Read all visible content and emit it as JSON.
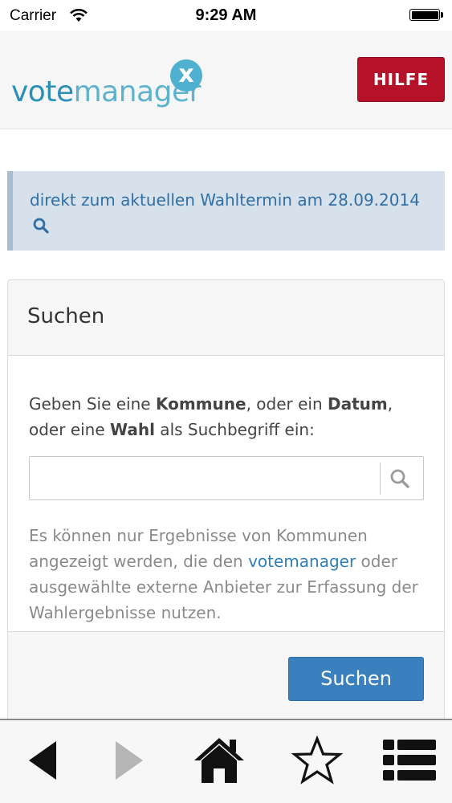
{
  "status_bar": {
    "carrier": "Carrier",
    "time": "9:29 AM"
  },
  "header": {
    "logo": {
      "word_1": "vote",
      "word_2": "manager",
      "badge": "x"
    },
    "help_button": "HILFE"
  },
  "notice": {
    "text": "direkt zum aktuellen Wahltermin am 28.09.2014",
    "icon": "search-icon"
  },
  "search_panel": {
    "title": "Suchen",
    "instruction": {
      "p1": "Geben Sie eine ",
      "b1": "Kommune",
      "p2": ", oder ein ",
      "b2": "Datum",
      "p3": ", oder eine ",
      "b3": "Wahl",
      "p4": " als Suchbegriff ein:"
    },
    "input": {
      "value": "",
      "placeholder": ""
    },
    "info": {
      "before": "Es können nur Ergebnisse von Kommunen angezeigt werden, die den ",
      "link": "votemanager",
      "after": " oder ausgewählte externe Anbieter zur Erfassung der Wahlergebnisse nutzen."
    },
    "submit_button": "Suchen"
  },
  "toolbar": {
    "items": [
      "back-icon",
      "forward-icon",
      "home-icon",
      "star-icon",
      "list-icon"
    ]
  },
  "colors": {
    "accent_blue": "#3a80be",
    "help_red": "#b5122a",
    "notice_bg": "#d7e1eb",
    "logo_blue": "#2a8fb8"
  }
}
